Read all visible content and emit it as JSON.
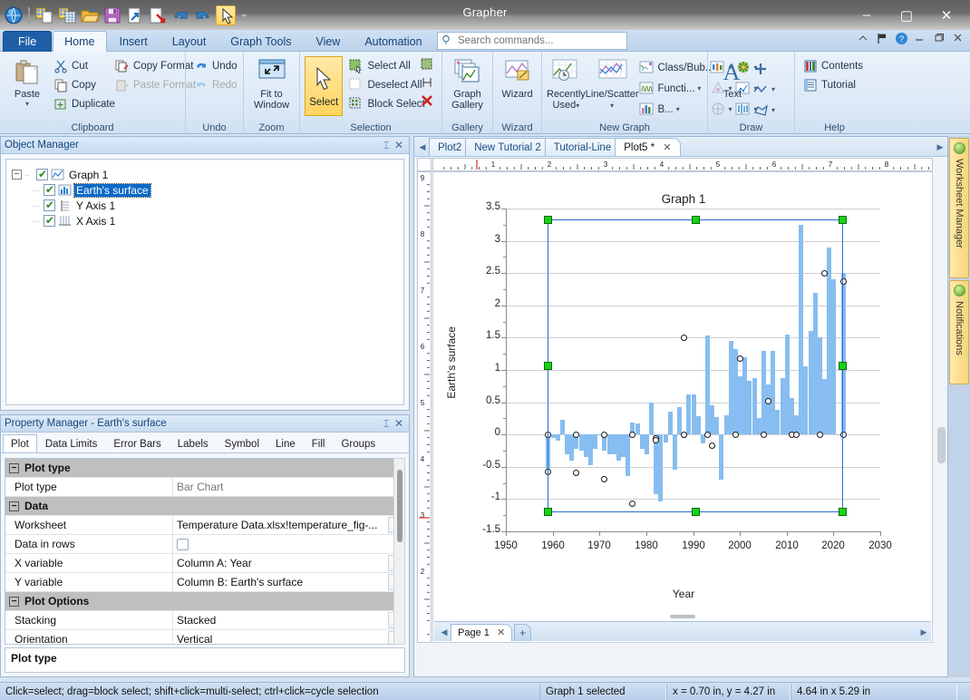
{
  "window": {
    "title": "Grapher",
    "minimize": "–",
    "maximize": "▢",
    "close": "✕"
  },
  "quick_access": [
    {
      "name": "grapher-orb-icon"
    },
    {
      "name": "new-plot-icon"
    },
    {
      "name": "new-worksheet-icon"
    },
    {
      "name": "open-icon"
    },
    {
      "name": "save-icon"
    },
    {
      "name": "export-icon"
    },
    {
      "name": "import-icon"
    },
    {
      "name": "undo-icon"
    },
    {
      "name": "redo-icon"
    },
    {
      "name": "select-tool-icon"
    },
    {
      "name": "customize-qat-icon"
    }
  ],
  "ribbon": {
    "tabs": [
      {
        "label": "File",
        "active": false,
        "file": true
      },
      {
        "label": "Home",
        "active": true
      },
      {
        "label": "Insert",
        "active": false
      },
      {
        "label": "Layout",
        "active": false
      },
      {
        "label": "Graph Tools",
        "active": false
      },
      {
        "label": "View",
        "active": false
      },
      {
        "label": "Automation",
        "active": false
      }
    ],
    "search": {
      "placeholder": "Search commands...",
      "value": ""
    },
    "groups": {
      "clipboard": {
        "label": "Clipboard",
        "paste": "Paste",
        "items": [
          {
            "label": "Cut",
            "icon": "cut-icon",
            "disabled": false
          },
          {
            "label": "Copy",
            "icon": "copy-icon",
            "disabled": false
          },
          {
            "label": "Duplicate",
            "icon": "duplicate-icon",
            "disabled": false
          },
          {
            "label": "Copy Format",
            "icon": "copy-format-icon",
            "disabled": false
          },
          {
            "label": "Paste Format",
            "icon": "paste-format-icon",
            "disabled": true
          }
        ]
      },
      "undo": {
        "label": "Undo",
        "items": [
          {
            "label": "Undo",
            "icon": "undo-icon",
            "disabled": false
          },
          {
            "label": "Redo",
            "icon": "redo-icon",
            "disabled": true
          }
        ]
      },
      "zoom": {
        "label": "Zoom",
        "fit": "Fit to\nWindow",
        "fit_line1": "Fit to",
        "fit_line2": "Window"
      },
      "selection": {
        "label": "Selection",
        "select": "Select",
        "items": [
          {
            "label": "Select All",
            "icon": "select-all-icon"
          },
          {
            "label": "Deselect All",
            "icon": "deselect-all-icon"
          },
          {
            "label": "Block Select",
            "icon": "block-select-icon"
          }
        ],
        "extra": [
          {
            "name": "marquee-icon"
          },
          {
            "name": "invert-selection-icon"
          },
          {
            "name": "delete-selection-icon"
          }
        ]
      },
      "gallery": {
        "label": "Gallery",
        "button_line1": "Graph",
        "button_line2": "Gallery"
      },
      "wizard": {
        "label": "Wizard",
        "button": "Wizard"
      },
      "new_graph": {
        "label": "New Graph",
        "recent_line1": "Recently",
        "recent_line2": "Used",
        "linescatter": "Line/Scatter",
        "items": [
          {
            "label": "Class/Bub...",
            "icon": "class-bubble-icon"
          },
          {
            "label": "Functi...",
            "icon": "function-plot-icon"
          },
          {
            "label": "B...",
            "icon": "bar-chart-icon"
          }
        ],
        "icon_only": [
          {
            "name": "box-plot-icon"
          },
          {
            "name": "ternary-icon"
          },
          {
            "name": "polar-icon"
          },
          {
            "name": "contour-icon"
          },
          {
            "name": "specialty-line-icon"
          },
          {
            "name": "statistics-icon"
          }
        ]
      },
      "draw": {
        "label": "Draw",
        "text": "Text",
        "icons": [
          {
            "name": "add-shape-icon"
          },
          {
            "name": "polyline-icon"
          },
          {
            "name": "polygon-icon"
          }
        ]
      },
      "help": {
        "label": "Help",
        "items": [
          {
            "label": "Contents",
            "icon": "contents-icon"
          },
          {
            "label": "Tutorial",
            "icon": "tutorial-icon"
          }
        ]
      }
    },
    "right_icons": [
      {
        "name": "collapse-ribbon-icon"
      },
      {
        "name": "flag-icon"
      },
      {
        "name": "help-icon"
      },
      {
        "name": "restore-window-icon"
      },
      {
        "name": "maximize-window-icon"
      },
      {
        "name": "close-window-icon"
      }
    ]
  },
  "object_manager": {
    "title": "Object Manager",
    "pin": "⌶",
    "close": "✕",
    "tree": [
      {
        "label": "Graph 1",
        "level": 0,
        "icon": "graph-icon",
        "checked": true,
        "selected": false
      },
      {
        "label": "Earth's surface",
        "level": 1,
        "icon": "bar-plot-icon",
        "checked": true,
        "selected": true
      },
      {
        "label": "Y Axis 1",
        "level": 1,
        "icon": "y-axis-icon",
        "checked": true,
        "selected": false
      },
      {
        "label": "X Axis 1",
        "level": 1,
        "icon": "x-axis-icon",
        "checked": true,
        "selected": false
      }
    ]
  },
  "property_manager": {
    "title": "Property Manager - Earth's surface",
    "pin": "⌶",
    "close": "✕",
    "tabs": [
      {
        "label": "Plot",
        "active": true
      },
      {
        "label": "Data Limits",
        "active": false
      },
      {
        "label": "Error Bars",
        "active": false
      },
      {
        "label": "Labels",
        "active": false
      },
      {
        "label": "Symbol",
        "active": false
      },
      {
        "label": "Line",
        "active": false
      },
      {
        "label": "Fill",
        "active": false
      },
      {
        "label": "Groups",
        "active": false
      }
    ],
    "rows": [
      {
        "kind": "header",
        "label": "Plot type",
        "expander": "−"
      },
      {
        "kind": "row",
        "label": "Plot type",
        "value": "Bar Chart",
        "control": "readonly"
      },
      {
        "kind": "header",
        "label": "Data",
        "expander": "−"
      },
      {
        "kind": "row",
        "label": "Worksheet",
        "value": "Temperature Data.xlsx!temperature_fig-...",
        "control": "dropdown"
      },
      {
        "kind": "row",
        "label": "Data in rows",
        "value": "",
        "control": "checkbox"
      },
      {
        "kind": "row",
        "label": "X variable",
        "value": "Column A: Year",
        "control": "dropdown"
      },
      {
        "kind": "row",
        "label": "Y variable",
        "value": "Column B: Earth's surface",
        "control": "dropdown"
      },
      {
        "kind": "header",
        "label": "Plot Options",
        "expander": "−"
      },
      {
        "kind": "row",
        "label": "Stacking",
        "value": "Stacked",
        "control": "dropdown"
      },
      {
        "kind": "row",
        "label": "Orientation",
        "value": "Vertical",
        "control": "dropdown"
      }
    ],
    "status": "Plot type"
  },
  "document": {
    "tabs": [
      {
        "label": "Plot2",
        "active": false,
        "closable": false
      },
      {
        "label": "New Tutorial 2",
        "active": false,
        "closable": false
      },
      {
        "label": "Tutorial-Line",
        "active": false,
        "closable": false
      },
      {
        "label": "Plot5 *",
        "active": true,
        "closable": true,
        "close": "✕"
      }
    ],
    "nav_left": "◀",
    "nav_right": "▶",
    "page_tab": "Page 1",
    "page_close": "✕",
    "page_add": "+",
    "ruler_h_labels": [
      "1",
      "2",
      "3",
      "4",
      "5",
      "6",
      "7",
      "8"
    ],
    "ruler_v_labels": [
      "9",
      "8",
      "7",
      "6",
      "5",
      "4",
      "3",
      "2"
    ]
  },
  "sidebar": {
    "tabs": [
      {
        "label": "Worksheet Manager"
      },
      {
        "label": "Notifications"
      }
    ]
  },
  "statusbar": {
    "hint": "Click=select; drag=block select; shift+click=multi-select; ctrl+click=cycle selection",
    "selection": "Graph 1 selected",
    "position": "x = 0.70 in, y = 4.27 in",
    "size": "4.64 in x 5.29 in"
  },
  "chart_data": {
    "type": "bar",
    "title": "Graph 1",
    "xlabel": "Year",
    "ylabel": "Earth's surface",
    "xlim": [
      1950,
      2030
    ],
    "ylim": [
      -1.5,
      3.5
    ],
    "xticks": [
      1950,
      1960,
      1970,
      1980,
      1990,
      2000,
      2010,
      2020,
      2030
    ],
    "yticks": [
      -1.5,
      -1,
      -0.5,
      0,
      0.5,
      1,
      1.5,
      2,
      2.5,
      3,
      3.5
    ],
    "grid": true,
    "legend": null,
    "bar_color": "#87bdf0",
    "series": [
      {
        "name": "Earth's surface",
        "x": [
          1959,
          1960,
          1961,
          1962,
          1963,
          1964,
          1965,
          1966,
          1967,
          1968,
          1969,
          1970,
          1971,
          1972,
          1973,
          1974,
          1975,
          1976,
          1977,
          1978,
          1979,
          1980,
          1981,
          1982,
          1983,
          1984,
          1985,
          1986,
          1987,
          1988,
          1989,
          1990,
          1991,
          1992,
          1993,
          1994,
          1995,
          1996,
          1997,
          1998,
          1999,
          2000,
          2001,
          2002,
          2003,
          2004,
          2005,
          2006,
          2007,
          2008,
          2009,
          2010,
          2011,
          2012,
          2013,
          2014,
          2015,
          2016,
          2017,
          2018,
          2019,
          2020,
          2021,
          2022
        ],
        "values": [
          -0.58,
          -0.05,
          -0.1,
          0.23,
          -0.3,
          -0.4,
          -0.22,
          -0.25,
          -0.35,
          -0.48,
          -0.22,
          0.0,
          -0.25,
          -0.3,
          -0.3,
          -0.4,
          -0.35,
          -0.65,
          0.19,
          0.17,
          -0.22,
          -0.3,
          0.5,
          -0.93,
          -1.03,
          -0.12,
          0.35,
          -0.55,
          0.42,
          -0.05,
          0.62,
          0.62,
          0.28,
          -0.14,
          1.53,
          0.45,
          0.27,
          -0.7,
          0.3,
          1.45,
          1.32,
          0.9,
          1.2,
          0.83,
          0.87,
          0.25,
          1.3,
          0.77,
          1.3,
          0.38,
          0.88,
          1.55,
          0.56,
          0.3,
          3.25,
          1.05,
          1.6,
          2.2,
          1.5,
          0.86,
          2.9,
          2.4,
          0.0,
          2.5
        ]
      }
    ],
    "symbol_points": {
      "note": "open circles overlaid on selected years",
      "x": [
        1959,
        1959,
        1965,
        1965,
        1971,
        1971,
        1977,
        1977,
        1982,
        1982,
        1988,
        1988,
        1993,
        1994,
        1999,
        2000,
        2005,
        2006,
        2011,
        2012,
        2017,
        2018,
        2022,
        2022
      ],
      "y": [
        0.0,
        -0.58,
        0.0,
        -0.59,
        0.0,
        -0.68,
        0.0,
        -1.07,
        -0.05,
        -0.08,
        0.0,
        1.5,
        0.0,
        -0.17,
        0.0,
        1.18,
        0.0,
        0.52,
        0.0,
        0.0,
        0.0,
        2.5,
        0.0,
        2.38
      ]
    },
    "selection_handles": {
      "visible": true,
      "color": "#17d317",
      "positions": [
        "top-left",
        "top-center",
        "top-right",
        "middle-left",
        "middle-right",
        "bottom-left",
        "bottom-center",
        "bottom-right"
      ]
    }
  }
}
